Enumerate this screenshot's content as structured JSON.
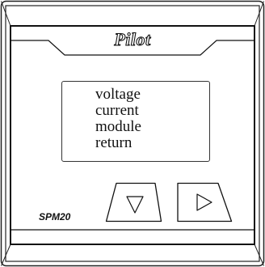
{
  "device": {
    "brand": "Pilot",
    "model": "SPM20"
  },
  "display": {
    "menu_items": [
      "voltage",
      "current",
      "module",
      "return"
    ]
  },
  "buttons": {
    "down_icon": "triangle-down-icon",
    "right_icon": "triangle-right-icon"
  }
}
